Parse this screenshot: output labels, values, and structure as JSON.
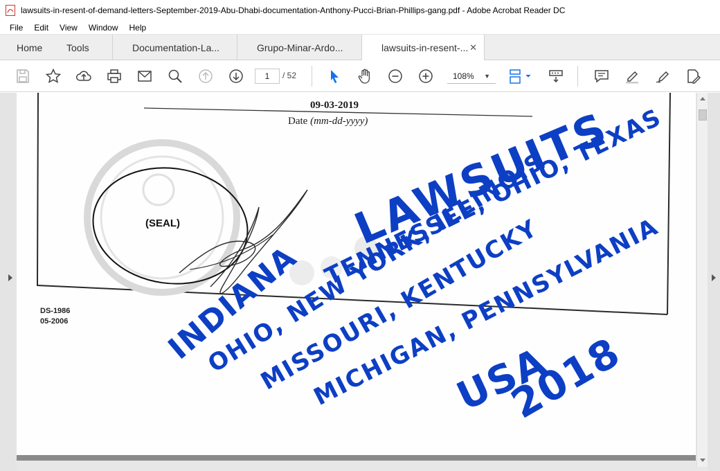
{
  "window": {
    "title": "lawsuits-in-resent-of-demand-letters-September-2019-Abu-Dhabi-documentation-Anthony-Pucci-Brian-Phillips-gang.pdf - Adobe Acrobat Reader DC"
  },
  "menu": [
    "File",
    "Edit",
    "View",
    "Window",
    "Help"
  ],
  "tabs": {
    "home": "Home",
    "tools": "Tools",
    "docs": [
      "Documentation-La...",
      "Grupo-Minar-Ardo...",
      "lawsuits-in-resent-..."
    ]
  },
  "toolbar": {
    "page_current": "1",
    "page_total": "/ 52",
    "zoom": "108%"
  },
  "document": {
    "date_value": "09-03-2019",
    "date_label_prefix": "Date ",
    "date_label_format": "(mm-dd-yyyy)",
    "seal_label": "(SEAL)",
    "form_number": "DS-1986",
    "form_date": "05-2006",
    "handwriting": {
      "line1": "LAWSUITS",
      "line2": "TENNESSEE, OHIO, TEXAS",
      "line3": "INDIANA",
      "line4": "OHIO, NEW YORK, ILLINOIS",
      "line5": "MISSOURI, KENTUCKY",
      "line6": "MICHIGAN, PENNSYLVANIA",
      "line7": "USA",
      "line8": "2018"
    },
    "ink_color": "#0d3fc4"
  }
}
